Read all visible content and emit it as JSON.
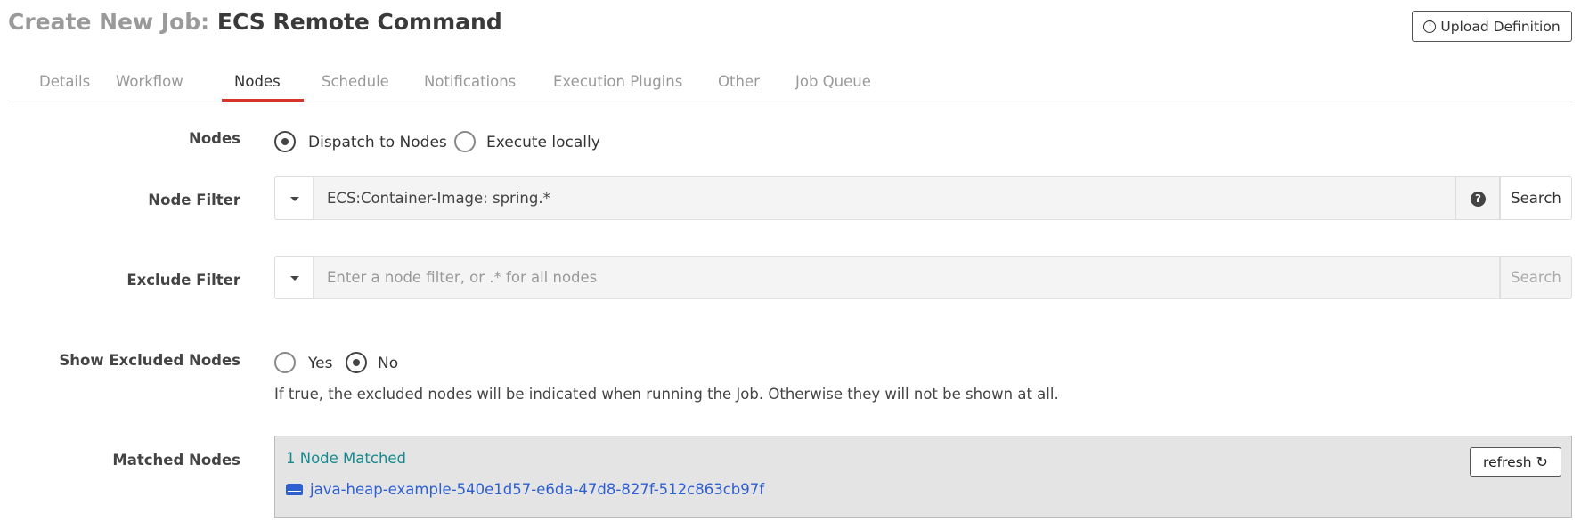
{
  "header": {
    "title_prefix": "Create New Job:",
    "title_name": "ECS Remote Command",
    "upload_label": "Upload Definition"
  },
  "tabs": [
    {
      "label": "Details"
    },
    {
      "label": "Workflow"
    },
    {
      "label": "Nodes",
      "active": true
    },
    {
      "label": "Schedule"
    },
    {
      "label": "Notifications"
    },
    {
      "label": "Execution Plugins"
    },
    {
      "label": "Other"
    },
    {
      "label": "Job Queue"
    }
  ],
  "nodes": {
    "label": "Nodes",
    "options": [
      "Dispatch to Nodes",
      "Execute locally"
    ],
    "selected": "Dispatch to Nodes"
  },
  "node_filter": {
    "label": "Node Filter",
    "value": "ECS:Container-Image: spring.*",
    "search_label": "Search"
  },
  "exclude_filter": {
    "label": "Exclude Filter",
    "value": "",
    "placeholder": "Enter a node filter, or .* for all nodes",
    "search_label": "Search"
  },
  "show_excluded": {
    "label": "Show Excluded Nodes",
    "options": [
      "Yes",
      "No"
    ],
    "selected": "No",
    "help": "If true, the excluded nodes will be indicated when running the Job. Otherwise they will not be shown at all."
  },
  "matched": {
    "label": "Matched Nodes",
    "count_text": "1 Node Matched",
    "nodes": [
      "java-heap-example-540e1d57-e6da-47d8-827f-512c863cb97f"
    ],
    "refresh_label": "refresh"
  },
  "colors": {
    "accent_tab": "#d9342b",
    "matched_count": "#168a8c",
    "node_link": "#2e5fd1"
  }
}
